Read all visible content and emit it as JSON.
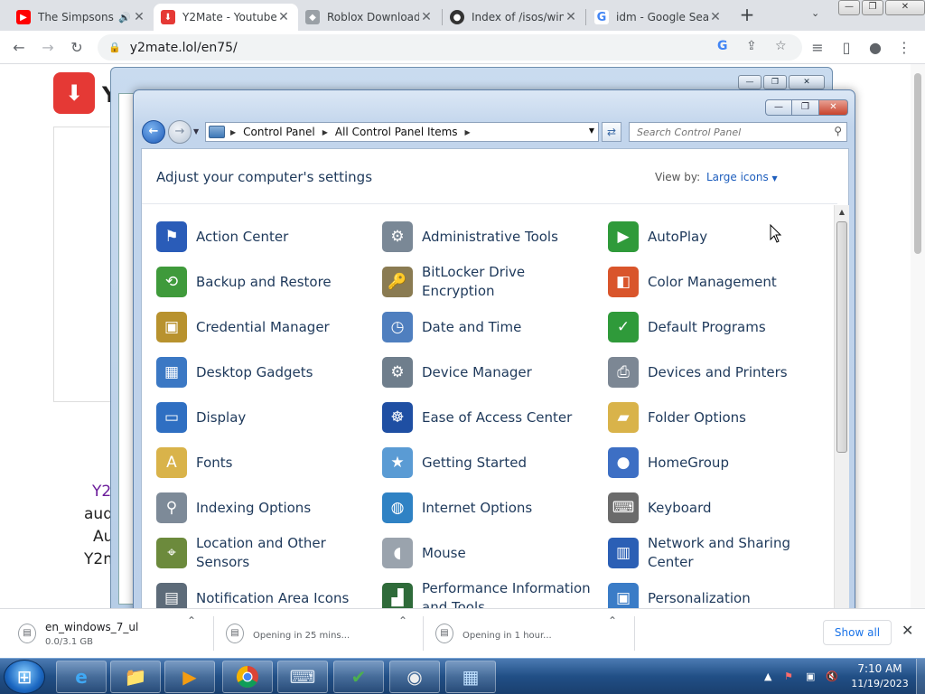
{
  "browser": {
    "tabs": [
      {
        "title": "The Simpsons",
        "icon": "youtube-icon",
        "color": "#ff0000",
        "audio": true
      },
      {
        "title": "Y2Mate - Youtube",
        "icon": "y2mate-icon",
        "color": "#e53935"
      },
      {
        "title": "Roblox Download",
        "icon": "roblox-icon",
        "color": "#9aa0a6"
      },
      {
        "title": "Index of /isos/win",
        "icon": "github-icon",
        "color": "#333333"
      },
      {
        "title": "idm - Google Sear",
        "icon": "google-icon",
        "color": "#4285f4"
      }
    ],
    "url": "y2mate.lol/en75/"
  },
  "page": {
    "logo_letter": "Y",
    "lines": [
      "Y2",
      "aud",
      "Au",
      "Y2m"
    ]
  },
  "downloads": [
    {
      "name": "en_windows_7_ul",
      "status": "0.0/3.1 GB"
    },
    {
      "name": "",
      "status": "Opening in 25 mins..."
    },
    {
      "name": "",
      "status": "Opening in 1 hour..."
    }
  ],
  "downloads_show_all": "Show all",
  "control_panel": {
    "breadcrumb": [
      "Control Panel",
      "All Control Panel Items"
    ],
    "search_placeholder": "Search Control Panel",
    "headline": "Adjust your computer's settings",
    "view_by_label": "View by:",
    "view_by_value": "Large icons",
    "items": [
      {
        "label": "Action Center",
        "icon": "flag-icon",
        "color": "#2a5cb8"
      },
      {
        "label": "Administrative Tools",
        "icon": "admin-tools-icon",
        "color": "#7a8896"
      },
      {
        "label": "AutoPlay",
        "icon": "autoplay-icon",
        "color": "#2f9a3a"
      },
      {
        "label": "Backup and Restore",
        "icon": "backup-icon",
        "color": "#3f9a3b"
      },
      {
        "label": "BitLocker Drive Encryption",
        "icon": "bitlocker-icon",
        "color": "#8a7b52"
      },
      {
        "label": "Color Management",
        "icon": "color-management-icon",
        "color": "#d9552b"
      },
      {
        "label": "Credential Manager",
        "icon": "credential-icon",
        "color": "#b8922e"
      },
      {
        "label": "Date and Time",
        "icon": "calendar-clock-icon",
        "color": "#4f7fbf"
      },
      {
        "label": "Default Programs",
        "icon": "default-programs-icon",
        "color": "#2f9a3a"
      },
      {
        "label": "Desktop Gadgets",
        "icon": "gadgets-icon",
        "color": "#3b78c4"
      },
      {
        "label": "Device Manager",
        "icon": "device-manager-icon",
        "color": "#6f7e8c"
      },
      {
        "label": "Devices and Printers",
        "icon": "printer-icon",
        "color": "#7c8794"
      },
      {
        "label": "Display",
        "icon": "display-icon",
        "color": "#2f6fc2"
      },
      {
        "label": "Ease of Access Center",
        "icon": "ease-of-access-icon",
        "color": "#1f4fa3"
      },
      {
        "label": "Folder Options",
        "icon": "folder-icon",
        "color": "#d9b34a"
      },
      {
        "label": "Fonts",
        "icon": "fonts-icon",
        "color": "#d9b34a"
      },
      {
        "label": "Getting Started",
        "icon": "getting-started-icon",
        "color": "#5a9bd4"
      },
      {
        "label": "HomeGroup",
        "icon": "homegroup-icon",
        "color": "#3d6fc4"
      },
      {
        "label": "Indexing Options",
        "icon": "indexing-icon",
        "color": "#7d8a98"
      },
      {
        "label": "Internet Options",
        "icon": "internet-options-icon",
        "color": "#2f82c4"
      },
      {
        "label": "Keyboard",
        "icon": "keyboard-icon",
        "color": "#6b6b6b"
      },
      {
        "label": "Location and Other Sensors",
        "icon": "sensors-icon",
        "color": "#6c8a3c"
      },
      {
        "label": "Mouse",
        "icon": "mouse-icon",
        "color": "#9aa3ad"
      },
      {
        "label": "Network and Sharing Center",
        "icon": "network-icon",
        "color": "#2b5fb5"
      },
      {
        "label": "Notification Area Icons",
        "icon": "notification-area-icon",
        "color": "#5d6b79"
      },
      {
        "label": "Performance Information and Tools",
        "icon": "performance-icon",
        "color": "#2f6b3a"
      },
      {
        "label": "Personalization",
        "icon": "personalization-icon",
        "color": "#3a7cc7"
      }
    ]
  },
  "taskbar": {
    "time": "7:10 AM",
    "date": "11/19/2023"
  }
}
